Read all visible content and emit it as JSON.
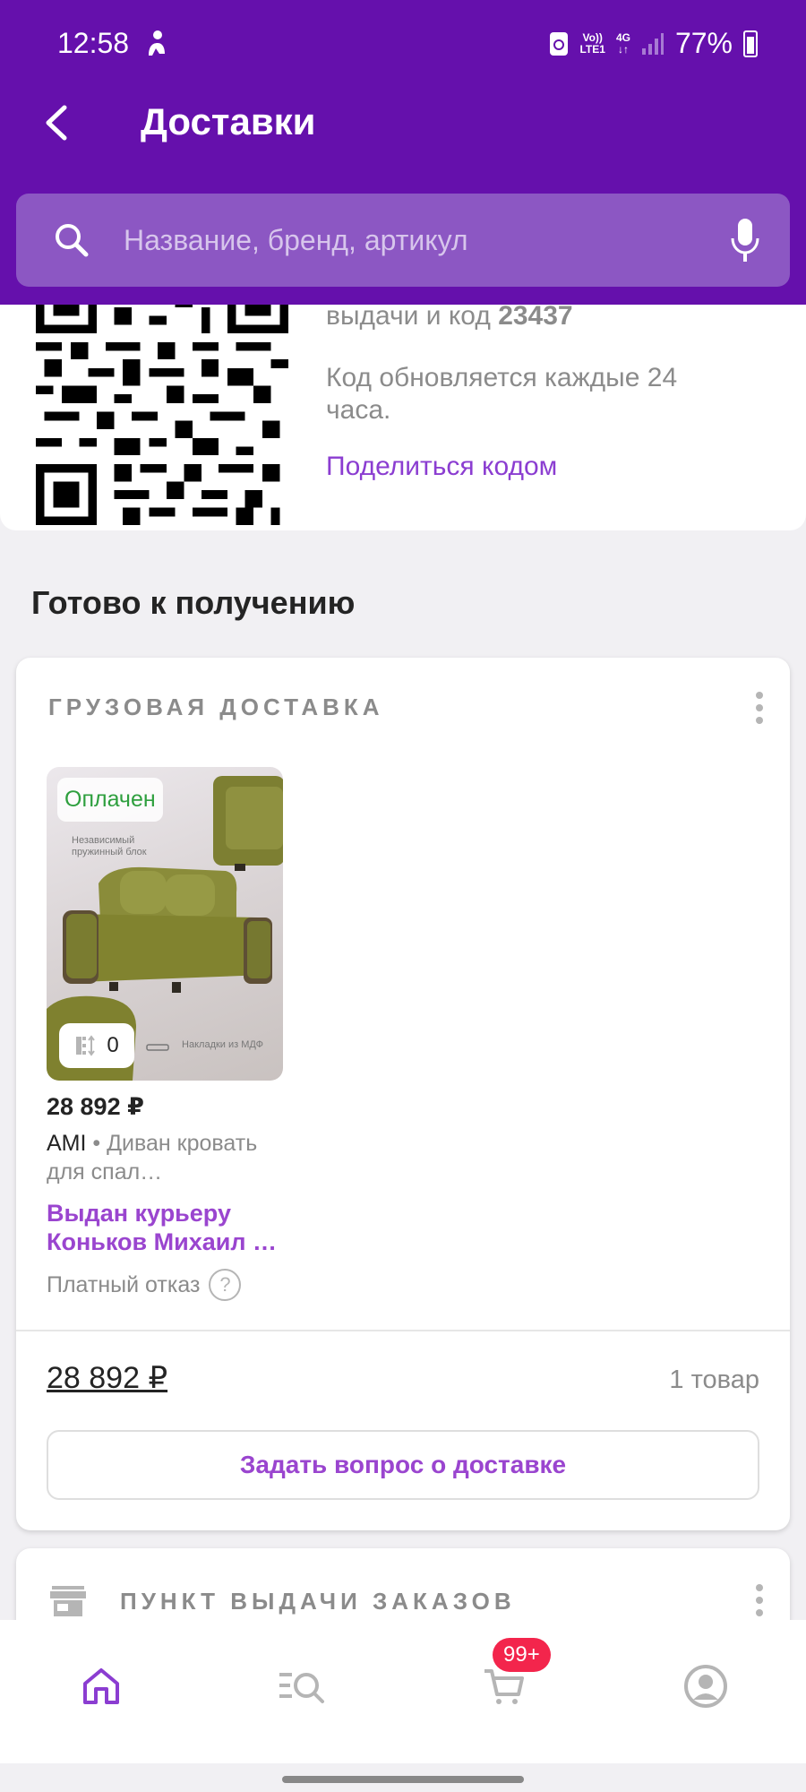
{
  "status_bar": {
    "time": "12:58",
    "network_top": "Vo))",
    "network_bottom": "LTE1",
    "network_gen": "4G",
    "battery": "77%"
  },
  "header": {
    "title": "Доставки"
  },
  "search": {
    "placeholder": "Название, бренд, артикул"
  },
  "qr_block": {
    "pickup_code_prefix": "выдачи и код",
    "code": "23437",
    "update_note": "Код обновляется каждые 24 часа.",
    "share_label": "Поделиться кодом"
  },
  "section": {
    "ready_title": "Готово к получению"
  },
  "cargo": {
    "label": "ГРУЗОВАЯ ДОСТАВКА",
    "product": {
      "badge": "Оплачен",
      "img_caption_1": "Независимый пружинный блок",
      "img_caption_2": "Накладки из МДФ",
      "counter": "0",
      "price": "28 892 ₽",
      "brand": "AMI",
      "name": " • Диван кровать для спал…",
      "status": "Выдан курьеру Коньков Михаил …",
      "refusal": "Платный отказ"
    },
    "total": "28 892 ₽",
    "items_count": "1 товар",
    "ask_button": "Задать вопрос о доставке"
  },
  "pickup": {
    "label": "ПУНКТ ВЫДАЧИ ЗАКАЗОВ"
  },
  "bottom_nav": {
    "cart_badge": "99+"
  },
  "colors": {
    "brand_purple": "#6510ac",
    "link_purple": "#9a45cf",
    "paid_green": "#2e9f3e",
    "badge_red": "#f3254c"
  }
}
